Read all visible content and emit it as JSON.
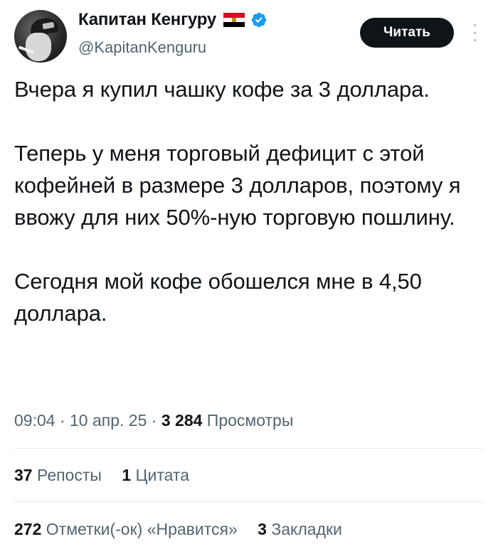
{
  "author": {
    "display_name": "Капитан Кенгуру",
    "handle": "@KapitanKenguru",
    "flag_icon": "egypt-flag-icon",
    "verified_icon": "verified-badge-icon",
    "verified_color": "#1d9bf0"
  },
  "follow_button": {
    "label": "Читать"
  },
  "tweet": {
    "paragraphs": [
      "Вчера я купил чашку кофе за 3 доллара.",
      "Теперь у меня торговый дефицит с этой кофейней в размере 3 долларов, поэтому я ввожу для них 50%-ную торговую пошлину.",
      "Сегодня мой кофе обошелся мне в 4,50 доллара."
    ]
  },
  "meta": {
    "time": "09:04",
    "separator": " · ",
    "date": "10 апр. 25",
    "views_count": "3 284",
    "views_label": "Просмотры"
  },
  "stats": {
    "reposts": {
      "count": "37",
      "label": "Репосты"
    },
    "quotes": {
      "count": "1",
      "label": "Цитата"
    },
    "likes": {
      "count": "272",
      "label": "Отметки(-ок) «Нравится»"
    },
    "bookmarks": {
      "count": "3",
      "label": "Закладки"
    }
  },
  "colors": {
    "text_primary": "#0f1419",
    "text_secondary": "#536471",
    "button_bg": "#0f1419",
    "divider": "#e6ecf0"
  }
}
